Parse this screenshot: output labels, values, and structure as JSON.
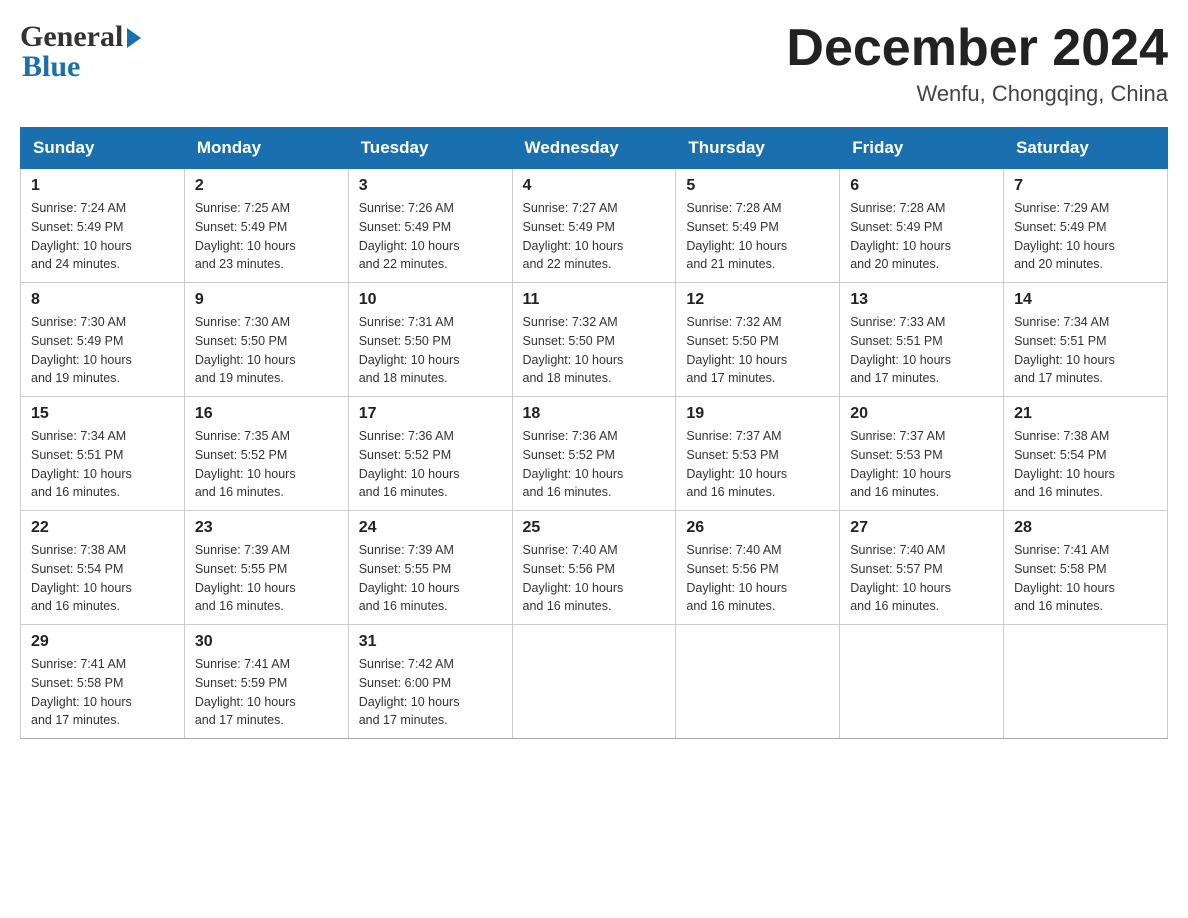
{
  "header": {
    "logo_general": "General",
    "logo_triangle": "▶",
    "logo_blue": "Blue",
    "month_title": "December 2024",
    "location": "Wenfu, Chongqing, China"
  },
  "days_of_week": [
    "Sunday",
    "Monday",
    "Tuesday",
    "Wednesday",
    "Thursday",
    "Friday",
    "Saturday"
  ],
  "weeks": [
    [
      {
        "day": "1",
        "sunrise": "7:24 AM",
        "sunset": "5:49 PM",
        "daylight": "10 hours and 24 minutes."
      },
      {
        "day": "2",
        "sunrise": "7:25 AM",
        "sunset": "5:49 PM",
        "daylight": "10 hours and 23 minutes."
      },
      {
        "day": "3",
        "sunrise": "7:26 AM",
        "sunset": "5:49 PM",
        "daylight": "10 hours and 22 minutes."
      },
      {
        "day": "4",
        "sunrise": "7:27 AM",
        "sunset": "5:49 PM",
        "daylight": "10 hours and 22 minutes."
      },
      {
        "day": "5",
        "sunrise": "7:28 AM",
        "sunset": "5:49 PM",
        "daylight": "10 hours and 21 minutes."
      },
      {
        "day": "6",
        "sunrise": "7:28 AM",
        "sunset": "5:49 PM",
        "daylight": "10 hours and 20 minutes."
      },
      {
        "day": "7",
        "sunrise": "7:29 AM",
        "sunset": "5:49 PM",
        "daylight": "10 hours and 20 minutes."
      }
    ],
    [
      {
        "day": "8",
        "sunrise": "7:30 AM",
        "sunset": "5:49 PM",
        "daylight": "10 hours and 19 minutes."
      },
      {
        "day": "9",
        "sunrise": "7:30 AM",
        "sunset": "5:50 PM",
        "daylight": "10 hours and 19 minutes."
      },
      {
        "day": "10",
        "sunrise": "7:31 AM",
        "sunset": "5:50 PM",
        "daylight": "10 hours and 18 minutes."
      },
      {
        "day": "11",
        "sunrise": "7:32 AM",
        "sunset": "5:50 PM",
        "daylight": "10 hours and 18 minutes."
      },
      {
        "day": "12",
        "sunrise": "7:32 AM",
        "sunset": "5:50 PM",
        "daylight": "10 hours and 17 minutes."
      },
      {
        "day": "13",
        "sunrise": "7:33 AM",
        "sunset": "5:51 PM",
        "daylight": "10 hours and 17 minutes."
      },
      {
        "day": "14",
        "sunrise": "7:34 AM",
        "sunset": "5:51 PM",
        "daylight": "10 hours and 17 minutes."
      }
    ],
    [
      {
        "day": "15",
        "sunrise": "7:34 AM",
        "sunset": "5:51 PM",
        "daylight": "10 hours and 16 minutes."
      },
      {
        "day": "16",
        "sunrise": "7:35 AM",
        "sunset": "5:52 PM",
        "daylight": "10 hours and 16 minutes."
      },
      {
        "day": "17",
        "sunrise": "7:36 AM",
        "sunset": "5:52 PM",
        "daylight": "10 hours and 16 minutes."
      },
      {
        "day": "18",
        "sunrise": "7:36 AM",
        "sunset": "5:52 PM",
        "daylight": "10 hours and 16 minutes."
      },
      {
        "day": "19",
        "sunrise": "7:37 AM",
        "sunset": "5:53 PM",
        "daylight": "10 hours and 16 minutes."
      },
      {
        "day": "20",
        "sunrise": "7:37 AM",
        "sunset": "5:53 PM",
        "daylight": "10 hours and 16 minutes."
      },
      {
        "day": "21",
        "sunrise": "7:38 AM",
        "sunset": "5:54 PM",
        "daylight": "10 hours and 16 minutes."
      }
    ],
    [
      {
        "day": "22",
        "sunrise": "7:38 AM",
        "sunset": "5:54 PM",
        "daylight": "10 hours and 16 minutes."
      },
      {
        "day": "23",
        "sunrise": "7:39 AM",
        "sunset": "5:55 PM",
        "daylight": "10 hours and 16 minutes."
      },
      {
        "day": "24",
        "sunrise": "7:39 AM",
        "sunset": "5:55 PM",
        "daylight": "10 hours and 16 minutes."
      },
      {
        "day": "25",
        "sunrise": "7:40 AM",
        "sunset": "5:56 PM",
        "daylight": "10 hours and 16 minutes."
      },
      {
        "day": "26",
        "sunrise": "7:40 AM",
        "sunset": "5:56 PM",
        "daylight": "10 hours and 16 minutes."
      },
      {
        "day": "27",
        "sunrise": "7:40 AM",
        "sunset": "5:57 PM",
        "daylight": "10 hours and 16 minutes."
      },
      {
        "day": "28",
        "sunrise": "7:41 AM",
        "sunset": "5:58 PM",
        "daylight": "10 hours and 16 minutes."
      }
    ],
    [
      {
        "day": "29",
        "sunrise": "7:41 AM",
        "sunset": "5:58 PM",
        "daylight": "10 hours and 17 minutes."
      },
      {
        "day": "30",
        "sunrise": "7:41 AM",
        "sunset": "5:59 PM",
        "daylight": "10 hours and 17 minutes."
      },
      {
        "day": "31",
        "sunrise": "7:42 AM",
        "sunset": "6:00 PM",
        "daylight": "10 hours and 17 minutes."
      },
      null,
      null,
      null,
      null
    ]
  ],
  "labels": {
    "sunrise": "Sunrise:",
    "sunset": "Sunset:",
    "daylight": "Daylight:"
  }
}
